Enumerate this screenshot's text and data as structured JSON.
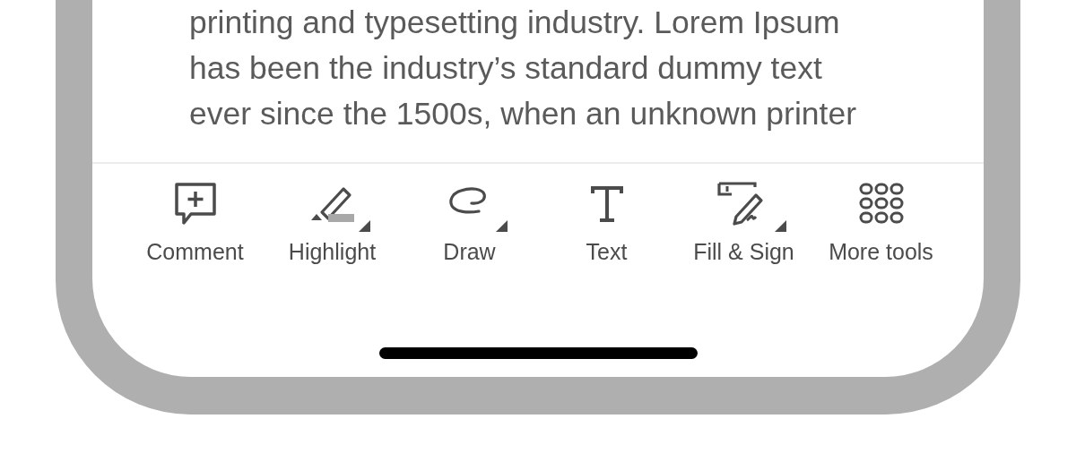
{
  "document": {
    "lines": [
      "printing and typesetting industry. Lorem Ipsum",
      "has been the industry’s standard dummy text",
      "ever since the 1500s, when an unknown printer"
    ]
  },
  "toolbar": [
    {
      "kind": "comment",
      "label": "Comment",
      "menu": false
    },
    {
      "kind": "highlight",
      "label": "Highlight",
      "menu": true
    },
    {
      "kind": "draw",
      "label": "Draw",
      "menu": true
    },
    {
      "kind": "text",
      "label": "Text",
      "menu": false
    },
    {
      "kind": "fill_sign",
      "label": "Fill & Sign",
      "menu": true
    },
    {
      "kind": "more",
      "label": "More tools",
      "menu": false
    }
  ]
}
